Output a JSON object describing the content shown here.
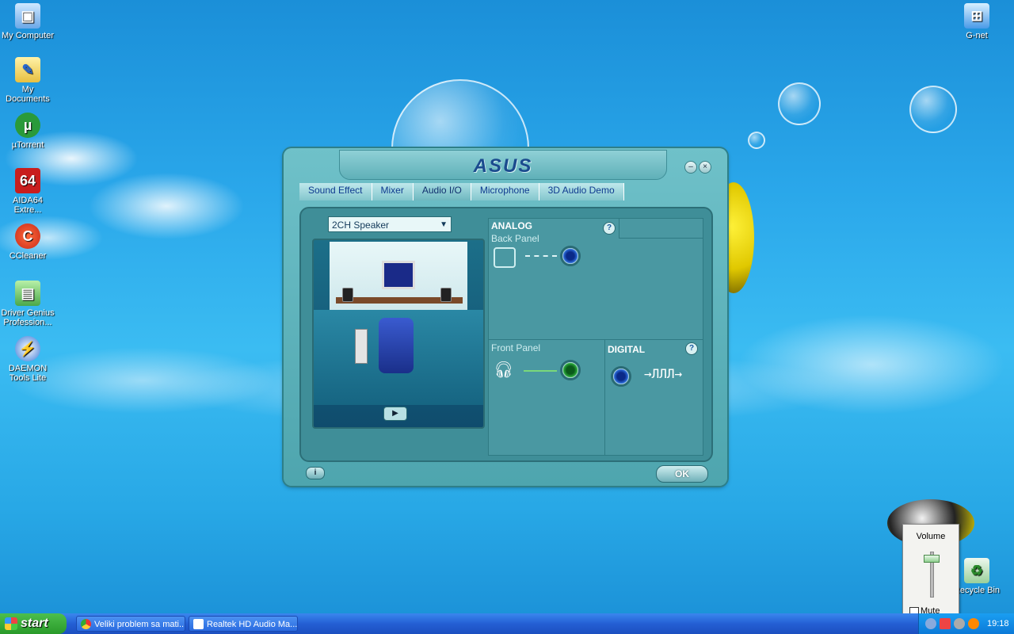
{
  "desktop": {
    "icons_left": [
      {
        "label": "My Computer",
        "glyph": "computer-icon"
      },
      {
        "label": "My Documents",
        "glyph": "folder-icon"
      },
      {
        "label": "µTorrent",
        "glyph": "utorrent-icon"
      },
      {
        "label": "AIDA64 Extre...",
        "glyph": "aida64-icon",
        "glyph_text": "64"
      },
      {
        "label": "CCleaner",
        "glyph": "ccleaner-icon"
      },
      {
        "label": "Driver Genius Profession...",
        "glyph": "driver-genius-icon"
      },
      {
        "label": "DAEMON Tools Lite",
        "glyph": "daemon-tools-icon"
      }
    ],
    "icon_gnet": {
      "label": "G-net"
    },
    "icon_recycle": {
      "label": "Recycle Bin"
    }
  },
  "window": {
    "logo": "ASUS",
    "tabs": [
      "Sound Effect",
      "Mixer",
      "Audio I/O",
      "Microphone",
      "3D Audio Demo"
    ],
    "active_tab": "Audio I/O",
    "speaker_select": "2CH Speaker",
    "analog": {
      "title": "ANALOG",
      "back_panel": "Back Panel",
      "front_panel": "Front Panel"
    },
    "digital": {
      "title": "DIGITAL"
    },
    "ok_label": "OK",
    "colors": {
      "frame": "#4ea5ae",
      "panel": "#3f8e98",
      "jack_blue": "#1a4aa8",
      "jack_green": "#1a8a2a",
      "tab_text": "#0e3a8f"
    }
  },
  "volume_popup": {
    "title": "Volume",
    "mute_label": "Mute",
    "level": 0.85
  },
  "taskbar": {
    "start_label": "start",
    "tasks": [
      {
        "label": "Veliki problem sa mati..."
      },
      {
        "label": "Realtek HD Audio Ma..."
      }
    ],
    "clock": "19:18"
  }
}
